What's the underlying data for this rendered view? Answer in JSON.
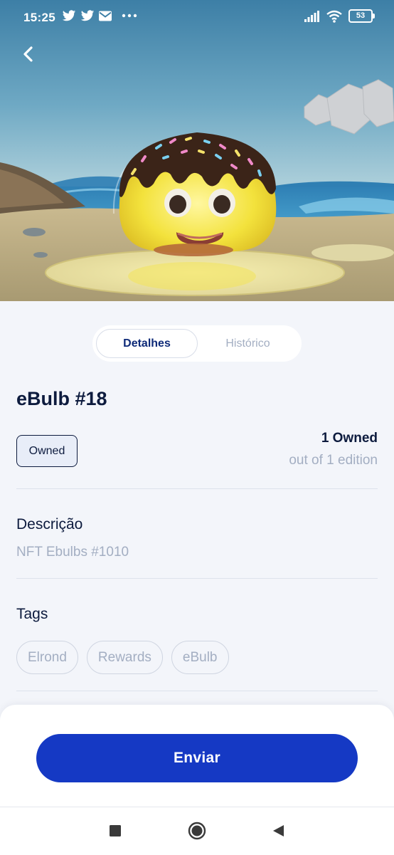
{
  "status_bar": {
    "time": "15:25",
    "left_icons": [
      "twitter-icon",
      "twitter-icon",
      "mail-icon",
      "more-dots-icon"
    ],
    "right_icons": [
      "signal-icon",
      "wifi-icon",
      "battery-icon"
    ],
    "battery_level": "53"
  },
  "hero": {
    "image_subject": "eBulb NFT artwork",
    "back_icon": "chevron-left-icon"
  },
  "tabs": [
    {
      "label": "Detalhes",
      "active": true
    },
    {
      "label": "Histórico",
      "active": false
    }
  ],
  "nft": {
    "title": "eBulb #18",
    "owned_badge": "Owned",
    "owned_count": "1 Owned",
    "edition": "out of 1 edition"
  },
  "description": {
    "heading": "Descrição",
    "text": "NFT Ebulbs #1010"
  },
  "tags": {
    "heading": "Tags",
    "items": [
      "Elrond",
      "Rewards",
      "eBulb"
    ]
  },
  "actions": {
    "send_label": "Enviar"
  },
  "nav_bar": {
    "icons": [
      "recents-square-icon",
      "home-circle-icon",
      "back-triangle-icon"
    ]
  },
  "colors": {
    "primary_button": "#1539c4",
    "title_text": "#0d1b3e",
    "muted_text": "#a3aec2",
    "page_background": "#f3f5fa"
  }
}
